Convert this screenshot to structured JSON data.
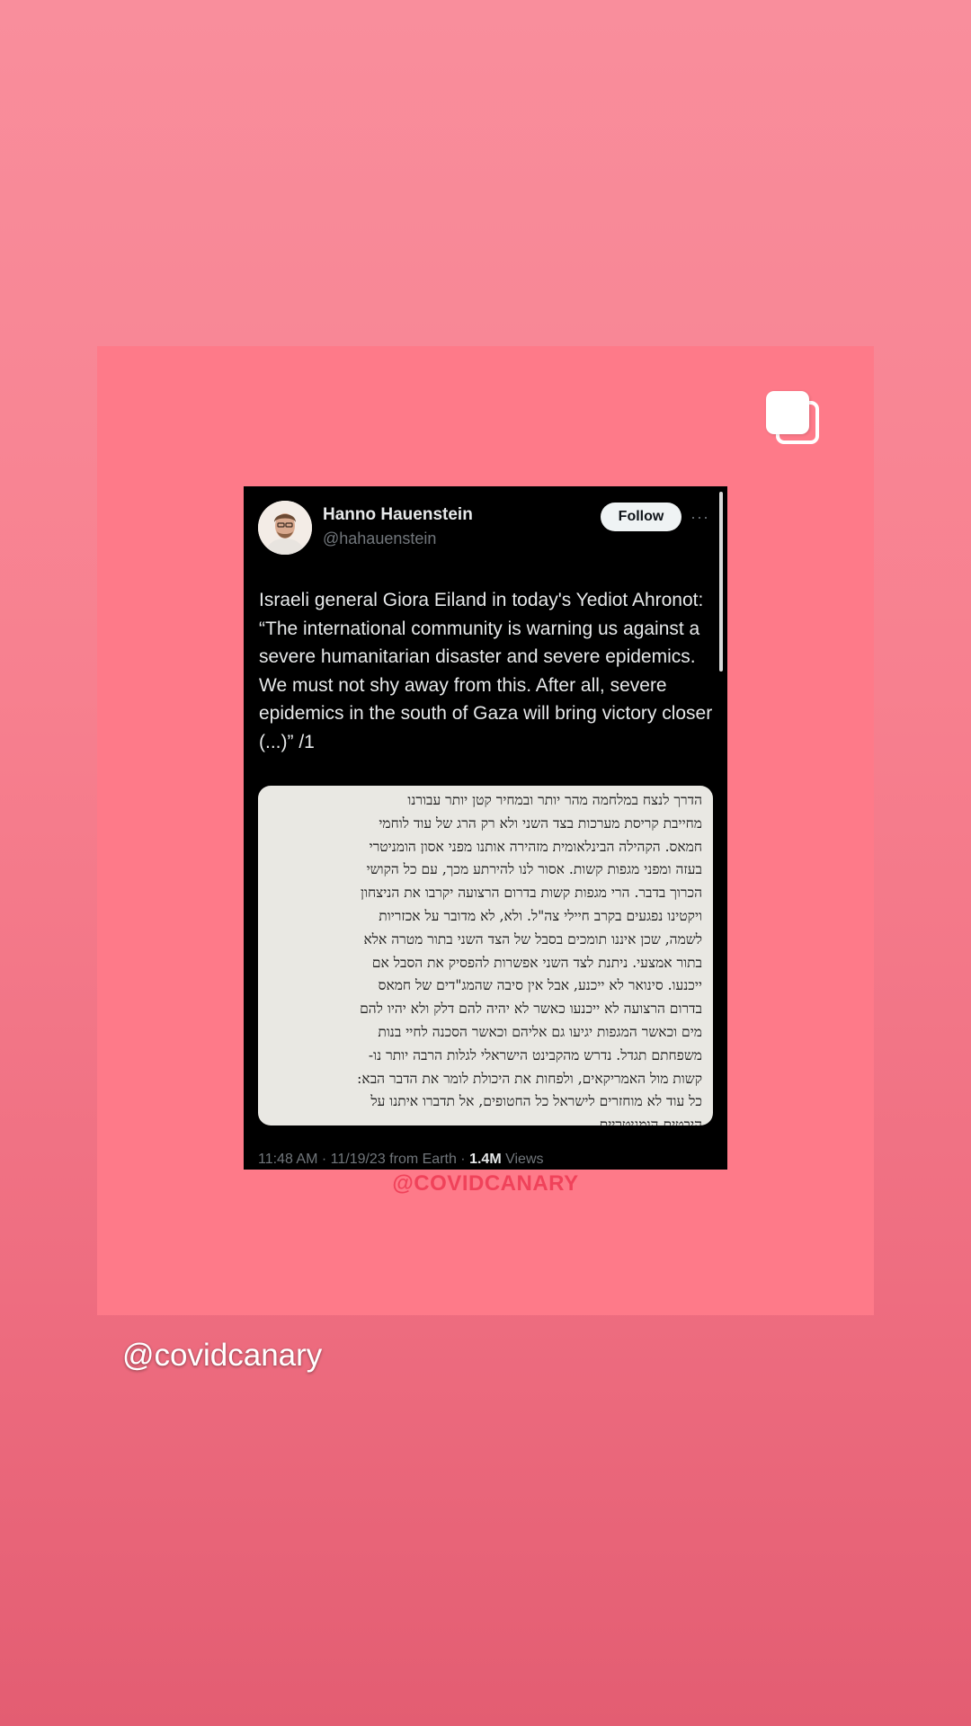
{
  "tweet": {
    "author_name": "Hanno Hauenstein",
    "author_handle": "@hahauenstein",
    "follow_label": "Follow",
    "more_label": "···",
    "text": "Israeli general Giora Eiland in today's Yediot Ahronot: “The international community is warning us against a severe humanitarian disaster and severe epidemics. We must not shy away from this. After all, severe epidemics in the south of Gaza will bring victory closer (...)” /1",
    "image_text_lines": [
      "הדרך לנצח במלחמה מהר יותר ובמחיר קטן יותר עבורנו",
      "מחייבת קריסת מערכות בצד השני ולא רק הרג של עוד לוחמי",
      "חמאס. הקהילה הבינלאומית מזהירה אותנו מפני אסון הומניטרי",
      "בעזה ומפני מגפות קשות. אסור לנו להירתע מכך, עם כל הקושי",
      "הכרוך בדבר. הרי מגפות קשות בדרום הרצועה יקרבו את הניצחון",
      "ויקטינו נפגעים בקרב חיילי צה\"ל. ולא, לא מדובר על אכזריות",
      "לשמה, שכן איננו תומכים בסבל של הצד השני בתור מטרה אלא",
      "בתור אמצעי. ניתנת לצד השני אפשרות להפסיק את הסבל אם",
      "ייכנעו. סינואר לא ייכנע, אבל אין סיבה שהמג\"דים של חמאס",
      "בדרום הרצועה לא ייכנעו כאשר לא יהיה להם דלק ולא יהיו להם",
      "מים וכאשר המגפות יגיעו גם אליהם וכאשר הסכנה לחיי בנות",
      "משפחתם תגדל. נדרש מהקבינט הישראלי לגלות הרבה יותר נו-",
      "קשות מול האמריקאים, ולפחות את היכולת לומר את הדבר הבא:",
      "כל עוד לא מוחזרים לישראל כל החטופים, אל תדברו איתנו על",
      "היבטים הומניטריים."
    ],
    "meta_time": "11:48 AM · 11/19/23 from Earth · ",
    "meta_views_count": "1.4M",
    "meta_views_label": " Views"
  },
  "watermark": "@COVIDCANARY",
  "caption": "@covidcanary",
  "colors": {
    "background_top": "#f98e9c",
    "background_bottom": "#e35d72",
    "card": "#fe7a89",
    "watermark": "#f0425a",
    "tweet_bg": "#000000"
  },
  "icons": {
    "stack": "multiple-posts-icon",
    "more": "more-options-icon"
  }
}
